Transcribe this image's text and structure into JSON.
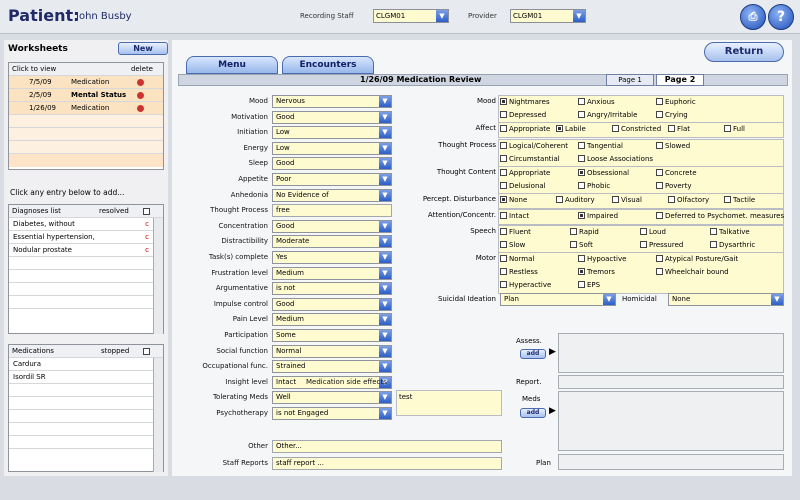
{
  "header": {
    "title": "Patient:",
    "patient_name": "John Busby",
    "recording_staff_label": "Recording Staff",
    "recording_staff_value": "CLGM01",
    "provider_label": "Provider",
    "provider_value": "CLGM01"
  },
  "worksheets": {
    "title": "Worksheets",
    "new_label": "New",
    "hint": "Click to view",
    "delete_label": "delete",
    "rows": [
      {
        "date": "7/5/09",
        "name": "Medication"
      },
      {
        "date": "2/5/09",
        "name": "Mental Status"
      },
      {
        "date": "1/26/09",
        "name": "Medication"
      }
    ]
  },
  "add_hint": "Click any entry below to add...",
  "diagnoses": {
    "title": "Diagnoses list",
    "resolved_label": "resolved",
    "rows": [
      "Diabetes, without",
      "Essential hypertension,",
      "Nodular prostate"
    ]
  },
  "medications": {
    "title": "Medications",
    "stopped_label": "stopped",
    "rows": [
      "Cardura",
      "Isordil SR"
    ]
  },
  "tabs": {
    "menu": "Menu",
    "encounters": "Encounters"
  },
  "return_label": "Return",
  "section_title": "1/26/09 Medication Review",
  "pages": {
    "page1": "Page 1",
    "page2": "Page 2"
  },
  "left_fields": [
    {
      "label": "Mood",
      "value": "Nervous",
      "dropdown": true
    },
    {
      "label": "Motivation",
      "value": "Good",
      "dropdown": true
    },
    {
      "label": "Initiation",
      "value": "Low",
      "dropdown": true
    },
    {
      "label": "Energy",
      "value": "Low",
      "dropdown": true
    },
    {
      "label": "Sleep",
      "value": "Good",
      "dropdown": true
    },
    {
      "label": "Appetite",
      "value": "Poor",
      "dropdown": true
    },
    {
      "label": "Anhedonia",
      "value": "No Evidence of",
      "dropdown": true
    },
    {
      "label": "Thought Process",
      "value": "free",
      "dropdown": false
    },
    {
      "label": "Concentration",
      "value": "Good",
      "dropdown": true
    },
    {
      "label": "Distractibility",
      "value": "Moderate",
      "dropdown": true
    },
    {
      "label": "Task(s) complete",
      "value": "Yes",
      "dropdown": true
    },
    {
      "label": "Frustration level",
      "value": "Medium",
      "dropdown": true
    },
    {
      "label": "Argumentative",
      "value": "is not",
      "dropdown": true
    },
    {
      "label": "Impulse control",
      "value": "Good",
      "dropdown": true
    },
    {
      "label": "Pain Level",
      "value": "Medium",
      "dropdown": true
    },
    {
      "label": "Participation",
      "value": "Some",
      "dropdown": true
    },
    {
      "label": "Social function",
      "value": "Normal",
      "dropdown": true
    },
    {
      "label": "Occupational func.",
      "value": "Strained",
      "dropdown": true
    },
    {
      "label": "Insight level",
      "value": "Intact",
      "dropdown": true
    },
    {
      "label": "Tolerating Meds",
      "value": "Well",
      "dropdown": true
    },
    {
      "label": "Psychotherapy",
      "value": "is not Engaged",
      "dropdown": true
    }
  ],
  "med_side_effects": {
    "label": "Medication side effects",
    "value": "test"
  },
  "other": {
    "label": "Other",
    "value": "Other..."
  },
  "staff_reports": {
    "label": "Staff Reports",
    "value": "staff report ..."
  },
  "right": {
    "mood": {
      "label": "Mood",
      "items": [
        [
          "Nightmares",
          "Anxious",
          "Euphoric"
        ],
        [
          "Depressed",
          "Angry/Irritable",
          "Crying"
        ]
      ],
      "checked": [
        "Nightmares"
      ]
    },
    "affect": {
      "label": "Affect",
      "items": [
        [
          "Appropriate",
          "Labile",
          "Constricted",
          "Flat",
          "Full"
        ]
      ],
      "checked": [
        "Labile"
      ]
    },
    "thought_process": {
      "label": "Thought Process",
      "items": [
        [
          "Logical/Coherent",
          "Tangential",
          "Slowed"
        ],
        [
          "Circumstantial",
          "Loose Associations"
        ]
      ],
      "checked": []
    },
    "thought_content": {
      "label": "Thought Content",
      "items": [
        [
          "Appropriate",
          "Obsessional",
          "Concrete"
        ],
        [
          "Delusional",
          "Phobic",
          "Poverty"
        ]
      ],
      "checked": [
        "Obsessional"
      ]
    },
    "perceptual": {
      "label": "Percept. Disturbance",
      "items": [
        [
          "None",
          "Auditory",
          "Visual",
          "Olfactory",
          "Tactile"
        ]
      ],
      "checked": [
        "None"
      ]
    },
    "attention": {
      "label": "Attention/Concentr.",
      "items": [
        [
          "Intact",
          "Impaired",
          "Deferred to Psychomet. measures"
        ]
      ],
      "checked": [
        "Impaired"
      ]
    },
    "speech": {
      "label": "Speech",
      "items": [
        [
          "Fluent",
          "Rapid",
          "Loud",
          "Talkative"
        ],
        [
          "Slow",
          "Soft",
          "Pressured",
          "Dysarthric"
        ]
      ],
      "checked": []
    },
    "motor": {
      "label": "Motor",
      "items": [
        [
          "Normal",
          "Hypoactive",
          "Atypical Posture/Gait"
        ],
        [
          "Restless",
          "Tremors",
          "Wheelchair bound"
        ],
        [
          "Hyperactive",
          "EPS"
        ]
      ],
      "checked": [
        "Tremors"
      ]
    },
    "suicidal": {
      "label": "Suicidal Ideation",
      "value": "Plan"
    },
    "homicidal": {
      "label": "Homicidal",
      "value": "None"
    },
    "assess_label": "Assess.",
    "add_label": "add",
    "report_label": "Report.",
    "meds_label": "Meds",
    "plan_label": "Plan"
  }
}
